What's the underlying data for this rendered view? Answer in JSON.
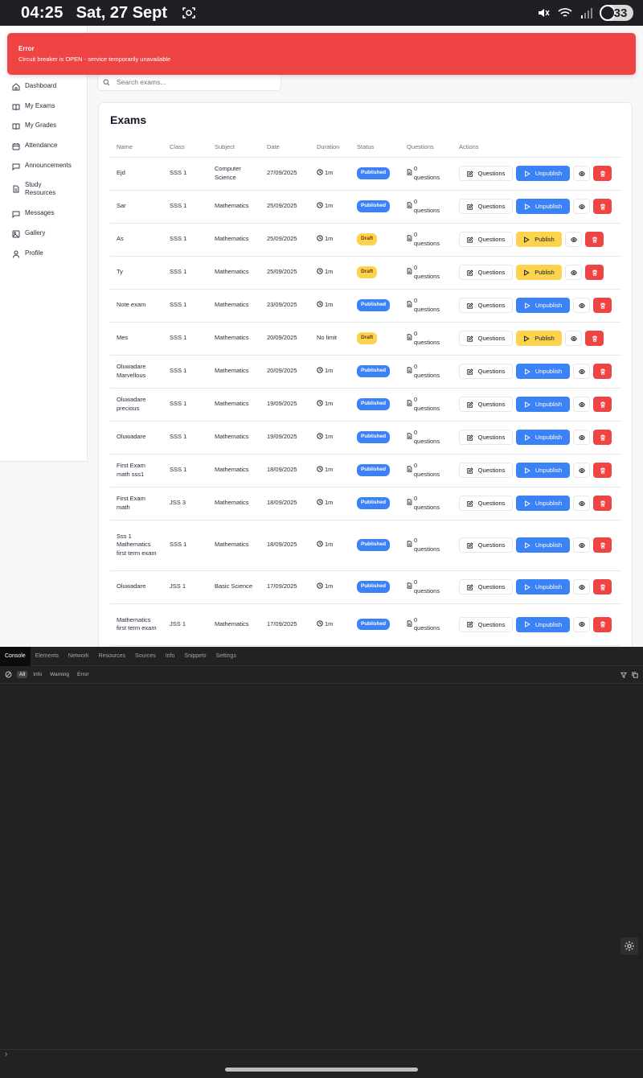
{
  "status_bar": {
    "time": "04:25",
    "date": "Sat, 27 Sept",
    "battery": "33"
  },
  "toast": {
    "title": "Error",
    "message": "Circuit breaker is OPEN - service temporarily unavailable"
  },
  "sidebar": {
    "items": [
      {
        "label": "Dashboard",
        "icon": "home-icon"
      },
      {
        "label": "My Exams",
        "icon": "book-open-icon"
      },
      {
        "label": "My Grades",
        "icon": "book-open-icon"
      },
      {
        "label": "Attendance",
        "icon": "calendar-icon"
      },
      {
        "label": "Announcements",
        "icon": "message-square-icon"
      },
      {
        "label": "Study Resources",
        "icon": "file-text-icon"
      },
      {
        "label": "Messages",
        "icon": "message-square-icon"
      },
      {
        "label": "Gallery",
        "icon": "image-icon"
      },
      {
        "label": "Profile",
        "icon": "user-icon"
      }
    ]
  },
  "search": {
    "placeholder": "Search exams..."
  },
  "exams": {
    "title": "Exams",
    "columns": [
      "Name",
      "Class",
      "Subject",
      "Date",
      "Duration",
      "Status",
      "Questions",
      "Actions"
    ],
    "actions": {
      "questions": "Questions",
      "publish": "Publish",
      "unpublish": "Unpublish"
    },
    "rows": [
      {
        "name": "Ejd",
        "class": "SSS 1",
        "subject": "Computer Science",
        "date": "27/09/2025",
        "duration": "1m",
        "status": "Published",
        "questions": "0 questions"
      },
      {
        "name": "Sar",
        "class": "SSS 1",
        "subject": "Mathematics",
        "date": "25/09/2025",
        "duration": "1m",
        "status": "Published",
        "questions": "0 questions"
      },
      {
        "name": "As",
        "class": "SSS 1",
        "subject": "Mathematics",
        "date": "25/09/2025",
        "duration": "1m",
        "status": "Draft",
        "questions": "0 questions"
      },
      {
        "name": "Ty",
        "class": "SSS 1",
        "subject": "Mathematics",
        "date": "25/09/2025",
        "duration": "1m",
        "status": "Draft",
        "questions": "0 questions"
      },
      {
        "name": "Note exam",
        "class": "SSS 1",
        "subject": "Mathematics",
        "date": "23/09/2025",
        "duration": "1m",
        "status": "Published",
        "questions": "0 questions"
      },
      {
        "name": "Mes",
        "class": "SSS 1",
        "subject": "Mathematics",
        "date": "20/09/2025",
        "duration": "No limit",
        "status": "Draft",
        "questions": "0 questions"
      },
      {
        "name": "Oluwadare Marvellous",
        "class": "SSS 1",
        "subject": "Mathematics",
        "date": "20/09/2025",
        "duration": "1m",
        "status": "Published",
        "questions": "0 questions"
      },
      {
        "name": "Oluwadare precious",
        "class": "SSS 1",
        "subject": "Mathematics",
        "date": "19/09/2025",
        "duration": "1m",
        "status": "Published",
        "questions": "0 questions"
      },
      {
        "name": "Oluwadare",
        "class": "SSS 1",
        "subject": "Mathematics",
        "date": "19/09/2025",
        "duration": "1m",
        "status": "Published",
        "questions": "0 questions"
      },
      {
        "name": "First Exam math sss1",
        "class": "SSS 1",
        "subject": "Mathematics",
        "date": "18/09/2025",
        "duration": "1m",
        "status": "Published",
        "questions": "0 questions"
      },
      {
        "name": "First Exam math",
        "class": "JSS 3",
        "subject": "Mathematics",
        "date": "18/09/2025",
        "duration": "1m",
        "status": "Published",
        "questions": "0 questions"
      },
      {
        "name": "Sss 1 Mathematics first term exam",
        "class": "SSS 1",
        "subject": "Mathematics",
        "date": "18/09/2025",
        "duration": "1m",
        "status": "Published",
        "questions": "0 questions"
      },
      {
        "name": "Oluwadare",
        "class": "JSS 1",
        "subject": "Basic Science",
        "date": "17/09/2025",
        "duration": "1m",
        "status": "Published",
        "questions": "0 questions"
      },
      {
        "name": "Mathematics first term exam",
        "class": "JSS 1",
        "subject": "Mathematics",
        "date": "17/09/2025",
        "duration": "1m",
        "status": "Published",
        "questions": "0 questions"
      }
    ]
  },
  "devtools": {
    "tabs": [
      "Console",
      "Elements",
      "Network",
      "Resources",
      "Sources",
      "Info",
      "Snippets",
      "Settings"
    ],
    "active_tab": "Console",
    "filters": [
      "All",
      "Info",
      "Warning",
      "Error"
    ],
    "active_filter": "All",
    "prompt": "›"
  },
  "colors": {
    "accent": "#3b82f6",
    "draft": "#fcd34d",
    "danger": "#ef4444"
  }
}
